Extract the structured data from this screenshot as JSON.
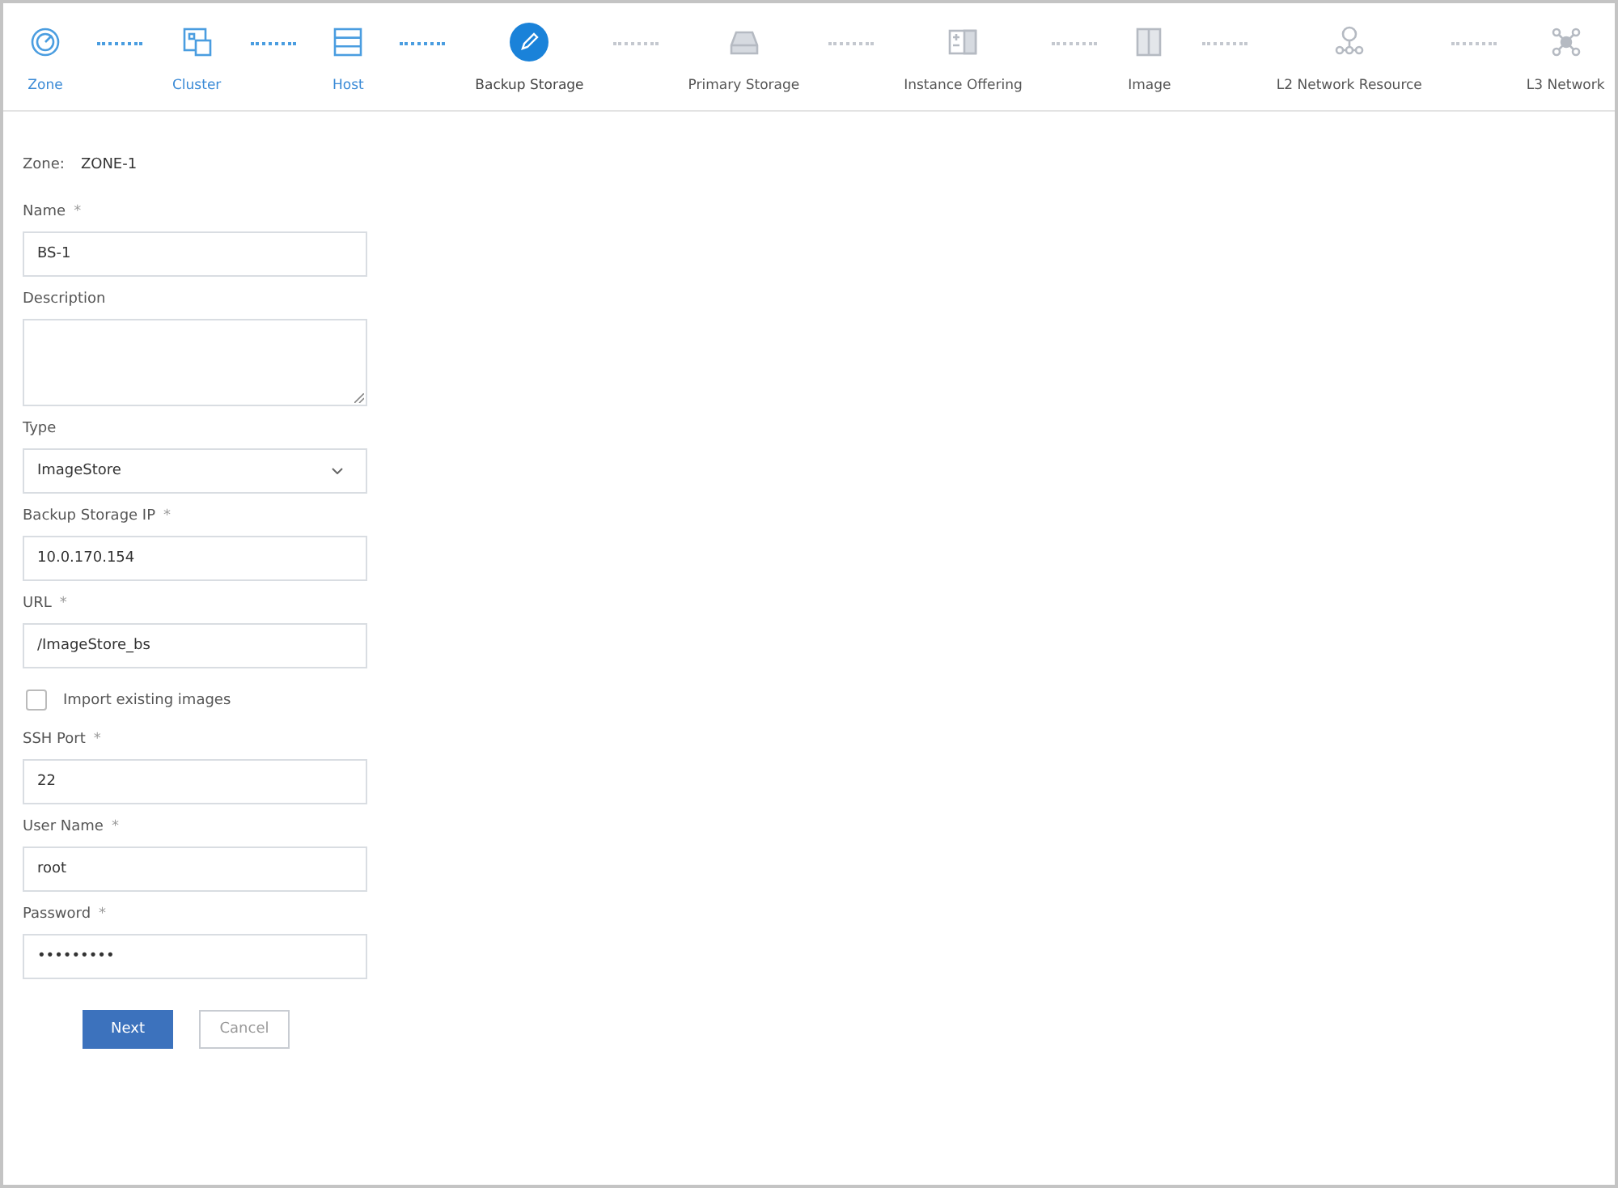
{
  "steps": [
    {
      "label": "Zone",
      "completed": true,
      "selected": false
    },
    {
      "label": "Cluster",
      "completed": true,
      "selected": false
    },
    {
      "label": "Host",
      "completed": true,
      "selected": false
    },
    {
      "label": "Backup Storage",
      "completed": false,
      "selected": true
    },
    {
      "label": "Primary Storage",
      "completed": false,
      "selected": false
    },
    {
      "label": "Instance Offering",
      "completed": false,
      "selected": false
    },
    {
      "label": "Image",
      "completed": false,
      "selected": false
    },
    {
      "label": "L2 Network Resource",
      "completed": false,
      "selected": false
    },
    {
      "label": "L3 Network",
      "completed": false,
      "selected": false
    }
  ],
  "zone": {
    "label": "Zone:",
    "value": "ZONE-1"
  },
  "fields": [
    {
      "kind": "text",
      "label": "Name",
      "required_mark": "*",
      "value": "BS-1"
    },
    {
      "kind": "textarea",
      "label": "Description"
    },
    {
      "kind": "select",
      "label": "Type",
      "value": "ImageStore"
    },
    {
      "kind": "text",
      "label": "Backup Storage IP",
      "required_mark": "*",
      "value": "10.0.170.154"
    },
    {
      "kind": "text",
      "label": "URL",
      "required_mark": "*",
      "value": "/ImageStore_bs"
    },
    {
      "kind": "checkbox",
      "label": "Import existing images",
      "checked": false
    },
    {
      "kind": "text",
      "label": "SSH Port",
      "required_mark": "*",
      "value": "22"
    },
    {
      "kind": "text",
      "label": "User Name",
      "required_mark": "*",
      "value": "root"
    },
    {
      "kind": "password",
      "label": "Password",
      "required_mark": "*",
      "value": "•••••••••"
    }
  ],
  "buttons": [
    {
      "label": "Next",
      "kind": "primary"
    },
    {
      "label": "Cancel",
      "kind": "secondary"
    }
  ]
}
